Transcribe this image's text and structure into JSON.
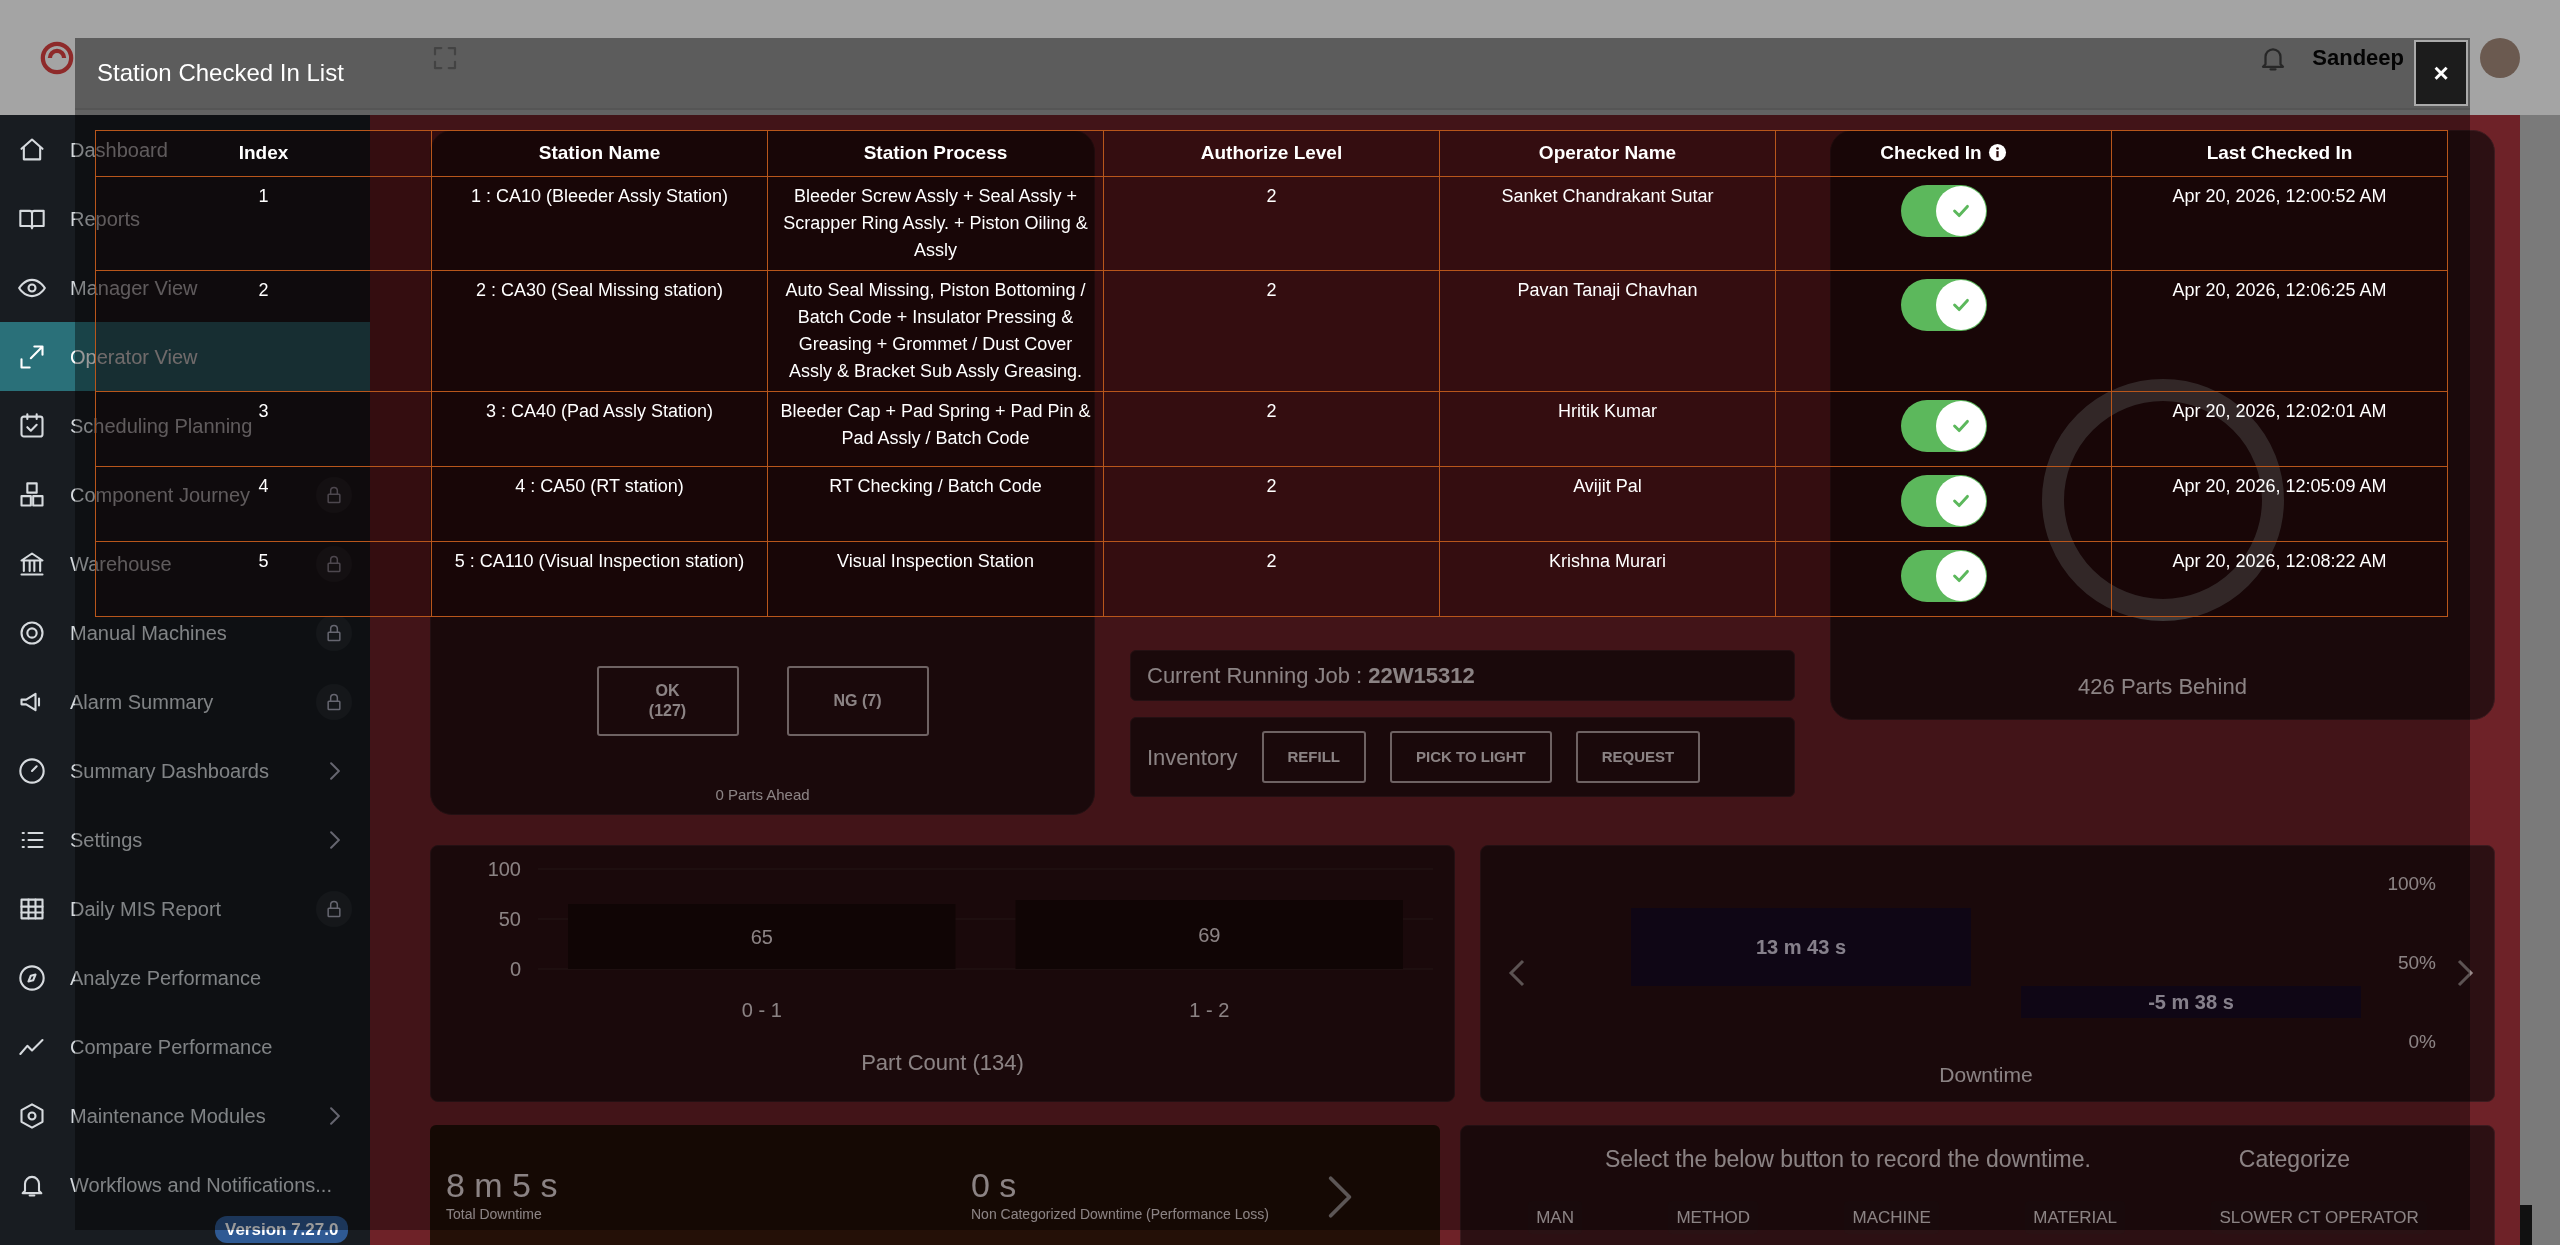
{
  "header": {
    "user_name": "Sandeep"
  },
  "sidebar": {
    "items": [
      {
        "label": "Dashboard",
        "kind": "plain",
        "selected": false
      },
      {
        "label": "Reports",
        "kind": "plain",
        "selected": false
      },
      {
        "label": "Manager View",
        "kind": "plain",
        "selected": false
      },
      {
        "label": "Operator View",
        "kind": "plain",
        "selected": true
      },
      {
        "label": "Scheduling Planning",
        "kind": "plain",
        "selected": false
      },
      {
        "label": "Component Journey",
        "kind": "locked",
        "selected": false
      },
      {
        "label": "Warehouse",
        "kind": "locked",
        "selected": false
      },
      {
        "label": "Manual Machines",
        "kind": "locked",
        "selected": false
      },
      {
        "label": "Alarm Summary",
        "kind": "locked",
        "selected": false
      },
      {
        "label": "Summary Dashboards",
        "kind": "submenu",
        "selected": false
      },
      {
        "label": "Settings",
        "kind": "submenu",
        "selected": false
      },
      {
        "label": "Daily MIS Report",
        "kind": "locked",
        "selected": false
      },
      {
        "label": "Analyze Performance",
        "kind": "plain",
        "selected": false
      },
      {
        "label": "Compare Performance",
        "kind": "plain",
        "selected": false
      },
      {
        "label": "Maintenance Modules",
        "kind": "submenu",
        "selected": false
      },
      {
        "label": "Workflows and Notifications...",
        "kind": "plain",
        "selected": false
      }
    ],
    "version": "Version 7.27.0"
  },
  "dashboard": {
    "quality_buttons": [
      "OK\n(127)",
      "NG (7)"
    ],
    "parts_ahead": "0 Parts Ahead",
    "current_job": {
      "label": "Current Running Job :",
      "value": "22W15312"
    },
    "inventory": {
      "label": "Inventory",
      "buttons": [
        "REFILL",
        "PICK TO LIGHT",
        "REQUEST"
      ]
    },
    "parts_behind": "426 Parts Behind",
    "part_count_chart": {
      "chart_data": {
        "type": "bar",
        "title": "Part Count (134)",
        "categories": [
          "0 - 1",
          "1 - 2"
        ],
        "values": [
          65,
          69
        ],
        "ylim": [
          0,
          100
        ],
        "yticks": [
          0,
          50,
          100
        ],
        "data_labels": true
      }
    },
    "downtime_chart": {
      "bars": [
        "13 m 43 s",
        "-5 m 38 s"
      ],
      "axis_labels": [
        "100%",
        "50%",
        "0%"
      ],
      "title": "Downtime"
    },
    "downtime_summary": {
      "total": "8 m 5 s",
      "total_label": "Total Downtime",
      "uncategorized": "0 s",
      "uncategorized_label": "Non Categorized Downtime (Performance Loss)"
    },
    "categorize": {
      "prompt": "Select the below button to record the downtime.",
      "title": "Categorize",
      "buttons": [
        "MAN",
        "METHOD",
        "MACHINE",
        "MATERIAL",
        "SLOWER CT OPERATOR"
      ]
    }
  },
  "modal": {
    "title": "Station Checked In List",
    "close": "×",
    "table": {
      "columns": [
        {
          "label": "Index",
          "info": false
        },
        {
          "label": "Station Name",
          "info": false
        },
        {
          "label": "Station Process",
          "info": false
        },
        {
          "label": "Authorize Level",
          "info": false
        },
        {
          "label": "Operator Name",
          "info": false
        },
        {
          "label": "Checked In",
          "info": true
        },
        {
          "label": "Last Checked In",
          "info": false
        }
      ],
      "rows": [
        {
          "index": "1",
          "station_name": "1 : CA10 (Bleeder Assly Station)",
          "station_process": "Bleeder Screw Assly + Seal Assly + Scrapper Ring Assly. + Piston Oiling & Assly",
          "authorize_level": "2",
          "operator_name": "Sanket Chandrakant Sutar",
          "checked_in": true,
          "last_checked_in": "Apr 20, 2026, 12:00:52 AM"
        },
        {
          "index": "2",
          "station_name": "2 : CA30 (Seal Missing station)",
          "station_process": "Auto Seal Missing, Piston Bottoming / Batch Code + Insulator Pressing & Greasing + Grommet / Dust Cover Assly & Bracket Sub Assly Greasing.",
          "authorize_level": "2",
          "operator_name": "Pavan Tanaji Chavhan",
          "checked_in": true,
          "last_checked_in": "Apr 20, 2026, 12:06:25 AM"
        },
        {
          "index": "3",
          "station_name": "3 : CA40 (Pad Assly Station)",
          "station_process": "Bleeder Cap + Pad Spring + Pad Pin & Pad Assly / Batch Code",
          "authorize_level": "2",
          "operator_name": "Hritik Kumar",
          "checked_in": true,
          "last_checked_in": "Apr 20, 2026, 12:02:01 AM"
        },
        {
          "index": "4",
          "station_name": "4 : CA50 (RT station)",
          "station_process": "RT Checking / Batch Code",
          "authorize_level": "2",
          "operator_name": "Avijit Pal",
          "checked_in": true,
          "last_checked_in": "Apr 20, 2026, 12:05:09 AM"
        },
        {
          "index": "5",
          "station_name": "5 : CA110 (Visual Inspection station)",
          "station_process": "Visual Inspection Station",
          "authorize_level": "2",
          "operator_name": "Krishna Murari",
          "checked_in": true,
          "last_checked_in": "Apr 20, 2026, 12:08:22 AM"
        }
      ]
    }
  }
}
